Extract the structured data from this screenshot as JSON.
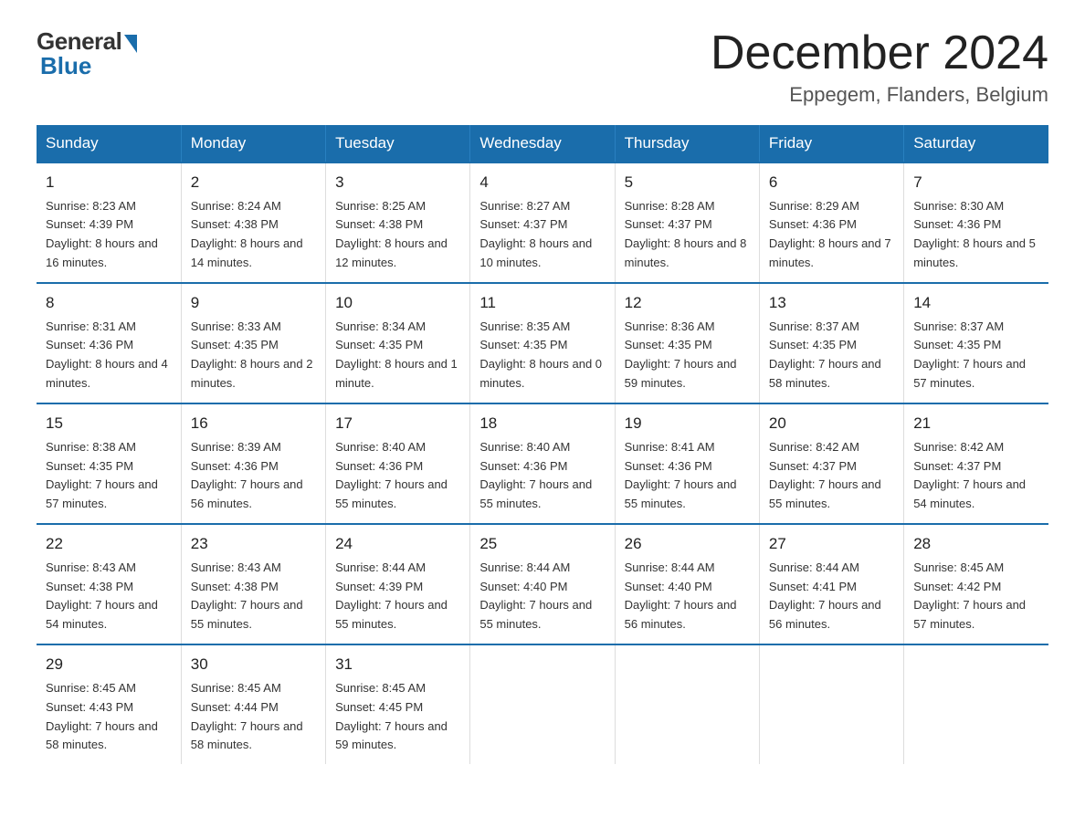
{
  "logo": {
    "general": "General",
    "blue": "Blue"
  },
  "title": "December 2024",
  "subtitle": "Eppegem, Flanders, Belgium",
  "days_of_week": [
    "Sunday",
    "Monday",
    "Tuesday",
    "Wednesday",
    "Thursday",
    "Friday",
    "Saturday"
  ],
  "weeks": [
    [
      {
        "day": "1",
        "sunrise": "8:23 AM",
        "sunset": "4:39 PM",
        "daylight": "8 hours and 16 minutes."
      },
      {
        "day": "2",
        "sunrise": "8:24 AM",
        "sunset": "4:38 PM",
        "daylight": "8 hours and 14 minutes."
      },
      {
        "day": "3",
        "sunrise": "8:25 AM",
        "sunset": "4:38 PM",
        "daylight": "8 hours and 12 minutes."
      },
      {
        "day": "4",
        "sunrise": "8:27 AM",
        "sunset": "4:37 PM",
        "daylight": "8 hours and 10 minutes."
      },
      {
        "day": "5",
        "sunrise": "8:28 AM",
        "sunset": "4:37 PM",
        "daylight": "8 hours and 8 minutes."
      },
      {
        "day": "6",
        "sunrise": "8:29 AM",
        "sunset": "4:36 PM",
        "daylight": "8 hours and 7 minutes."
      },
      {
        "day": "7",
        "sunrise": "8:30 AM",
        "sunset": "4:36 PM",
        "daylight": "8 hours and 5 minutes."
      }
    ],
    [
      {
        "day": "8",
        "sunrise": "8:31 AM",
        "sunset": "4:36 PM",
        "daylight": "8 hours and 4 minutes."
      },
      {
        "day": "9",
        "sunrise": "8:33 AM",
        "sunset": "4:35 PM",
        "daylight": "8 hours and 2 minutes."
      },
      {
        "day": "10",
        "sunrise": "8:34 AM",
        "sunset": "4:35 PM",
        "daylight": "8 hours and 1 minute."
      },
      {
        "day": "11",
        "sunrise": "8:35 AM",
        "sunset": "4:35 PM",
        "daylight": "8 hours and 0 minutes."
      },
      {
        "day": "12",
        "sunrise": "8:36 AM",
        "sunset": "4:35 PM",
        "daylight": "7 hours and 59 minutes."
      },
      {
        "day": "13",
        "sunrise": "8:37 AM",
        "sunset": "4:35 PM",
        "daylight": "7 hours and 58 minutes."
      },
      {
        "day": "14",
        "sunrise": "8:37 AM",
        "sunset": "4:35 PM",
        "daylight": "7 hours and 57 minutes."
      }
    ],
    [
      {
        "day": "15",
        "sunrise": "8:38 AM",
        "sunset": "4:35 PM",
        "daylight": "7 hours and 57 minutes."
      },
      {
        "day": "16",
        "sunrise": "8:39 AM",
        "sunset": "4:36 PM",
        "daylight": "7 hours and 56 minutes."
      },
      {
        "day": "17",
        "sunrise": "8:40 AM",
        "sunset": "4:36 PM",
        "daylight": "7 hours and 55 minutes."
      },
      {
        "day": "18",
        "sunrise": "8:40 AM",
        "sunset": "4:36 PM",
        "daylight": "7 hours and 55 minutes."
      },
      {
        "day": "19",
        "sunrise": "8:41 AM",
        "sunset": "4:36 PM",
        "daylight": "7 hours and 55 minutes."
      },
      {
        "day": "20",
        "sunrise": "8:42 AM",
        "sunset": "4:37 PM",
        "daylight": "7 hours and 55 minutes."
      },
      {
        "day": "21",
        "sunrise": "8:42 AM",
        "sunset": "4:37 PM",
        "daylight": "7 hours and 54 minutes."
      }
    ],
    [
      {
        "day": "22",
        "sunrise": "8:43 AM",
        "sunset": "4:38 PM",
        "daylight": "7 hours and 54 minutes."
      },
      {
        "day": "23",
        "sunrise": "8:43 AM",
        "sunset": "4:38 PM",
        "daylight": "7 hours and 55 minutes."
      },
      {
        "day": "24",
        "sunrise": "8:44 AM",
        "sunset": "4:39 PM",
        "daylight": "7 hours and 55 minutes."
      },
      {
        "day": "25",
        "sunrise": "8:44 AM",
        "sunset": "4:40 PM",
        "daylight": "7 hours and 55 minutes."
      },
      {
        "day": "26",
        "sunrise": "8:44 AM",
        "sunset": "4:40 PM",
        "daylight": "7 hours and 56 minutes."
      },
      {
        "day": "27",
        "sunrise": "8:44 AM",
        "sunset": "4:41 PM",
        "daylight": "7 hours and 56 minutes."
      },
      {
        "day": "28",
        "sunrise": "8:45 AM",
        "sunset": "4:42 PM",
        "daylight": "7 hours and 57 minutes."
      }
    ],
    [
      {
        "day": "29",
        "sunrise": "8:45 AM",
        "sunset": "4:43 PM",
        "daylight": "7 hours and 58 minutes."
      },
      {
        "day": "30",
        "sunrise": "8:45 AM",
        "sunset": "4:44 PM",
        "daylight": "7 hours and 58 minutes."
      },
      {
        "day": "31",
        "sunrise": "8:45 AM",
        "sunset": "4:45 PM",
        "daylight": "7 hours and 59 minutes."
      },
      null,
      null,
      null,
      null
    ]
  ]
}
